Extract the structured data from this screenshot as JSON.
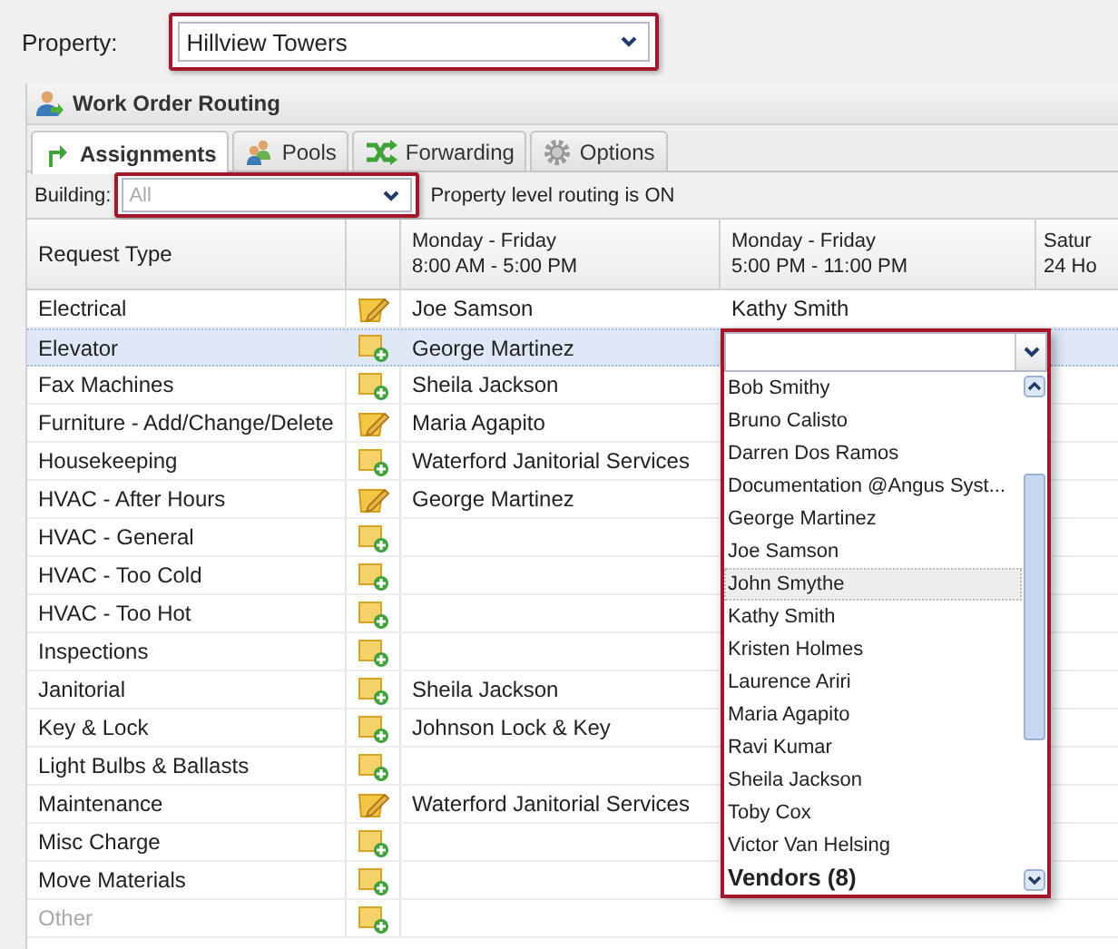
{
  "property": {
    "label": "Property:",
    "value": "Hillview Towers"
  },
  "panel": {
    "title": "Work Order Routing"
  },
  "tabs": [
    {
      "label": "Assignments",
      "kind": "assign",
      "selected": true
    },
    {
      "label": "Pools",
      "kind": "pools",
      "selected": false
    },
    {
      "label": "Forwarding",
      "kind": "forward",
      "selected": false
    },
    {
      "label": "Options",
      "kind": "options",
      "selected": false
    }
  ],
  "toolbar": {
    "building_label": "Building:",
    "building_placeholder": "All",
    "status": "Property level routing is ON"
  },
  "grid": {
    "type_header": "Request Type",
    "shift_headers": [
      {
        "days": "Monday - Friday",
        "hours": "8:00 AM - 5:00 PM"
      },
      {
        "days": "Monday - Friday",
        "hours": "5:00 PM - 11:00 PM"
      },
      {
        "days": "Satur",
        "hours": "24 Ho"
      }
    ],
    "rows": [
      {
        "type": "Electrical",
        "kind": "edit",
        "selected": false,
        "disabled": false,
        "assignees": [
          "Joe Samson",
          "Kathy Smith"
        ]
      },
      {
        "type": "Elevator",
        "kind": "add",
        "selected": true,
        "disabled": false,
        "assignees": [
          "George Martinez"
        ]
      },
      {
        "type": "Fax Machines",
        "kind": "add",
        "selected": false,
        "disabled": false,
        "assignees": [
          "Sheila Jackson"
        ]
      },
      {
        "type": "Furniture - Add/Change/Delete",
        "kind": "edit",
        "selected": false,
        "disabled": false,
        "assignees": [
          "Maria Agapito"
        ]
      },
      {
        "type": "Housekeeping",
        "kind": "add",
        "selected": false,
        "disabled": false,
        "assignees": [
          "Waterford Janitorial Services"
        ]
      },
      {
        "type": "HVAC - After Hours",
        "kind": "edit",
        "selected": false,
        "disabled": false,
        "assignees": [
          "George Martinez"
        ]
      },
      {
        "type": "HVAC - General",
        "kind": "add",
        "selected": false,
        "disabled": false
      },
      {
        "type": "HVAC - Too Cold",
        "kind": "add",
        "selected": false,
        "disabled": false
      },
      {
        "type": "HVAC - Too Hot",
        "kind": "add",
        "selected": false,
        "disabled": false
      },
      {
        "type": "Inspections",
        "kind": "add",
        "selected": false,
        "disabled": false
      },
      {
        "type": "Janitorial",
        "kind": "add",
        "selected": false,
        "disabled": false,
        "assignees": [
          "Sheila Jackson"
        ]
      },
      {
        "type": "Key & Lock",
        "kind": "add",
        "selected": false,
        "disabled": false,
        "assignees": [
          "Johnson Lock & Key"
        ]
      },
      {
        "type": "Light Bulbs & Ballasts",
        "kind": "add",
        "selected": false,
        "disabled": false
      },
      {
        "type": "Maintenance",
        "kind": "edit",
        "selected": false,
        "disabled": false,
        "assignees": [
          "Waterford Janitorial Services"
        ]
      },
      {
        "type": "Misc Charge",
        "kind": "add",
        "selected": false,
        "disabled": false
      },
      {
        "type": "Move Materials",
        "kind": "add",
        "selected": false,
        "disabled": false
      },
      {
        "type": "Other",
        "kind": "add",
        "selected": false,
        "disabled": true
      }
    ]
  },
  "dropdown": {
    "items": [
      {
        "label": "Bob Smithy",
        "selected": false
      },
      {
        "label": "Bruno Calisto",
        "selected": false
      },
      {
        "label": "Darren Dos Ramos",
        "selected": false
      },
      {
        "label": "Documentation @Angus Syst...",
        "selected": false
      },
      {
        "label": "George Martinez",
        "selected": false
      },
      {
        "label": "Joe Samson",
        "selected": false
      },
      {
        "label": "John Smythe",
        "selected": true
      },
      {
        "label": "Kathy Smith",
        "selected": false
      },
      {
        "label": "Kristen Holmes",
        "selected": false
      },
      {
        "label": "Laurence Ariri",
        "selected": false
      },
      {
        "label": "Maria Agapito",
        "selected": false
      },
      {
        "label": "Ravi Kumar",
        "selected": false
      },
      {
        "label": "Sheila Jackson",
        "selected": false
      },
      {
        "label": "Toby Cox",
        "selected": false
      },
      {
        "label": "Victor Van Helsing",
        "selected": false
      }
    ],
    "group_header": "Vendors (8)"
  }
}
